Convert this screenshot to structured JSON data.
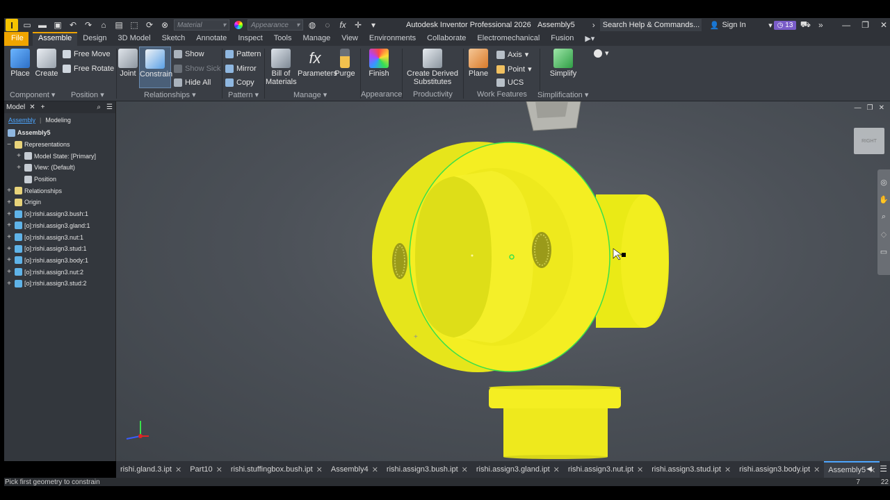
{
  "app": {
    "logo": "I",
    "title": "Autodesk Inventor Professional 2026",
    "document": "Assembly5"
  },
  "quick_access": {
    "material_placeholder": "Material",
    "appearance_placeholder": "Appearance",
    "fx": "fx"
  },
  "search": {
    "placeholder": "Search Help & Commands..."
  },
  "account": {
    "sign_in": "Sign In",
    "badge_count": "13"
  },
  "menu_tabs": [
    "File",
    "Assemble",
    "Design",
    "3D Model",
    "Sketch",
    "Annotate",
    "Inspect",
    "Tools",
    "Manage",
    "View",
    "Environments",
    "Collaborate",
    "Electromechanical",
    "Fusion"
  ],
  "ribbon": {
    "place": "Place",
    "create": "Create",
    "free_move": "Free Move",
    "free_rotate": "Free Rotate",
    "joint": "Joint",
    "constrain": "Constrain",
    "show": "Show",
    "show_sick": "Show Sick",
    "hide_all": "Hide All",
    "pattern": "Pattern",
    "mirror": "Mirror",
    "copy": "Copy",
    "bom_line1": "Bill of",
    "bom_line2": "Materials",
    "parameters": "Parameters",
    "purge": "Purge",
    "finish": "Finish",
    "derived_line1": "Create Derived",
    "derived_line2": "Substitutes",
    "plane": "Plane",
    "axis": "Axis",
    "point": "Point",
    "ucs": "UCS",
    "simplify": "Simplify",
    "groups": {
      "component": "Component ▾",
      "position": "Position ▾",
      "relationships": "Relationships ▾",
      "pattern": "Pattern ▾",
      "manage": "Manage ▾",
      "appearance": "Appearance",
      "productivity": "Productivity",
      "work_features": "Work Features",
      "simplification": "Simplification ▾"
    }
  },
  "browser": {
    "title": "Model",
    "subtab_assembly": "Assembly",
    "subtab_modeling": "Modeling",
    "root": "Assembly5",
    "items": [
      {
        "label": "Representations",
        "level": 1,
        "exp": "−"
      },
      {
        "label": "Model State: [Primary]",
        "level": 2,
        "exp": "+"
      },
      {
        "label": "View: (Default)",
        "level": 2,
        "exp": "+"
      },
      {
        "label": "Position",
        "level": 2,
        "exp": ""
      },
      {
        "label": "Relationships",
        "level": 1,
        "exp": "+"
      },
      {
        "label": "Origin",
        "level": 1,
        "exp": "+"
      },
      {
        "label": "[o]:rishi.assign3.bush:1",
        "level": 1,
        "exp": "+"
      },
      {
        "label": "[o]:rishi.assign3.gland:1",
        "level": 1,
        "exp": "+"
      },
      {
        "label": "[o]:rishi.assign3.nut:1",
        "level": 1,
        "exp": "+"
      },
      {
        "label": "[o]:rishi.assign3.stud:1",
        "level": 1,
        "exp": "+"
      },
      {
        "label": "[o]:rishi.assign3.body:1",
        "level": 1,
        "exp": "+"
      },
      {
        "label": "[o]:rishi.assign3.nut:2",
        "level": 1,
        "exp": "+"
      },
      {
        "label": "[o]:rishi.assign3.stud:2",
        "level": 1,
        "exp": "+"
      }
    ]
  },
  "viewcube": {
    "label": "RIGHT"
  },
  "doc_tabs": [
    {
      "label": "rishi.gland.3.ipt",
      "active": false
    },
    {
      "label": "Part10",
      "active": false
    },
    {
      "label": "rishi.stuffingbox.bush.ipt",
      "active": false
    },
    {
      "label": "Assembly4",
      "active": false
    },
    {
      "label": "rishi.assign3.bush.ipt",
      "active": false
    },
    {
      "label": "rishi.assign3.gland.ipt",
      "active": false
    },
    {
      "label": "rishi.assign3.nut.ipt",
      "active": false
    },
    {
      "label": "rishi.assign3.stud.ipt",
      "active": false
    },
    {
      "label": "rishi.assign3.body.ipt",
      "active": false
    },
    {
      "label": "Assembly5",
      "active": true
    }
  ],
  "status": {
    "message": "Pick first geometry to constrain",
    "count_a": "7",
    "count_b": "22"
  },
  "colors": {
    "accent": "#f0a500",
    "part_yellow": "#f2ec1a",
    "highlight_green": "#39e04a",
    "select_blue": "#4da6ff"
  }
}
